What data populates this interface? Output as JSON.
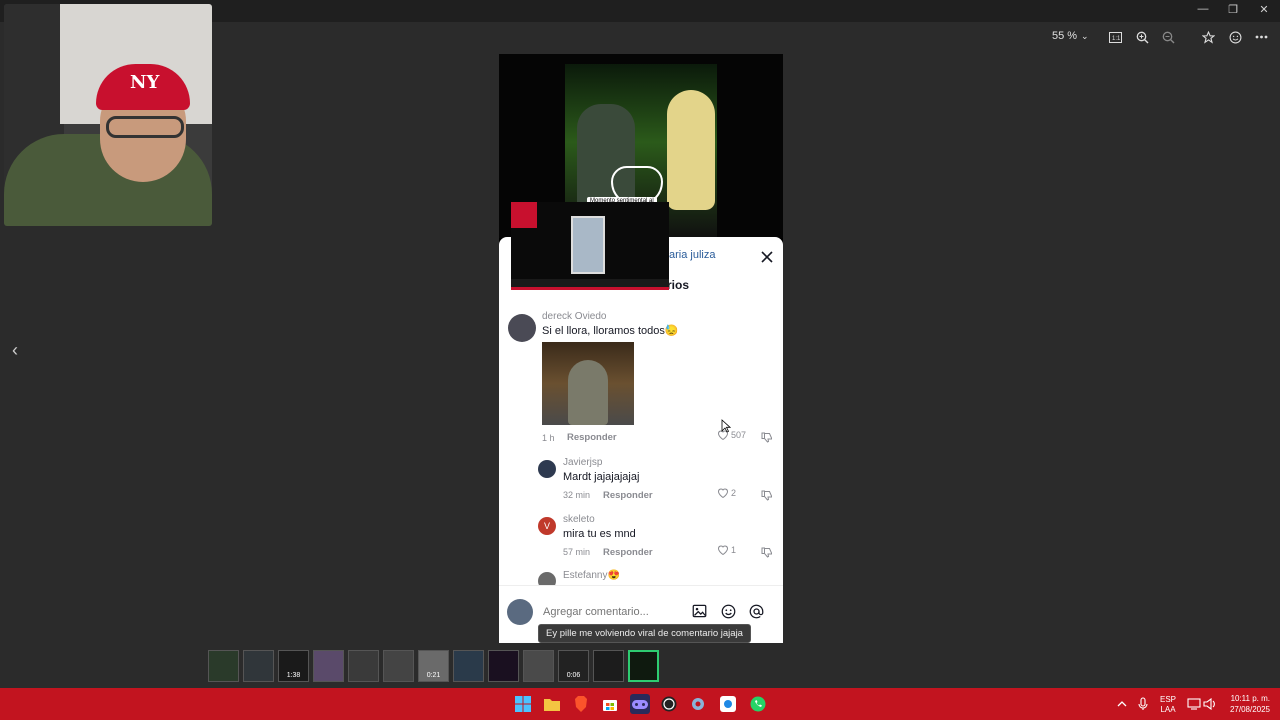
{
  "window": {
    "minimize_glyph": "—",
    "restore_glyph": "❐",
    "close_glyph": "✕"
  },
  "viewer_toolbar": {
    "zoom_level": "55 %"
  },
  "nav": {
    "prev_glyph": "‹"
  },
  "webcam": {
    "cap_logo": "NY"
  },
  "video": {
    "caption": "Momento sentimental al"
  },
  "sheet": {
    "tag": "aria juliza",
    "title_partial": "rios",
    "close_glyph": "✕",
    "comments": [
      {
        "user": "dereck Oviedo",
        "text": "Si el llora, lloramos todos😓",
        "time": "1 h",
        "reply": "Responder",
        "likes": "507"
      },
      {
        "user": "Javierjsp",
        "text": "Mardt jajajajajaj",
        "time": "32 min",
        "reply": "Responder",
        "likes": "2"
      },
      {
        "user": "skeleto",
        "avatar_letter": "V",
        "text": "mira tu es mnd",
        "time": "57 min",
        "reply": "Responder",
        "likes": "1"
      },
      {
        "user": "Estefanny😍"
      }
    ],
    "input_placeholder": "Agregar comentario..."
  },
  "tooltip": "Ey pille me volviendo viral de comentario jajaja",
  "thumbnails": [
    {
      "label": ""
    },
    {
      "label": ""
    },
    {
      "label": "1:38"
    },
    {
      "label": ""
    },
    {
      "label": ""
    },
    {
      "label": ""
    },
    {
      "label": "0:21"
    },
    {
      "label": ""
    },
    {
      "label": ""
    },
    {
      "label": ""
    },
    {
      "label": "0:06"
    },
    {
      "label": ""
    },
    {
      "label": ""
    }
  ],
  "taskbar": {
    "language_line1": "ESP",
    "language_line2": "LAA",
    "time": "10:11 p. m.",
    "date": "27/08/2025"
  },
  "colors": {
    "taskbar": "#c2141f",
    "link": "#2a5c9a",
    "active_thumb": "#2ecc71"
  }
}
